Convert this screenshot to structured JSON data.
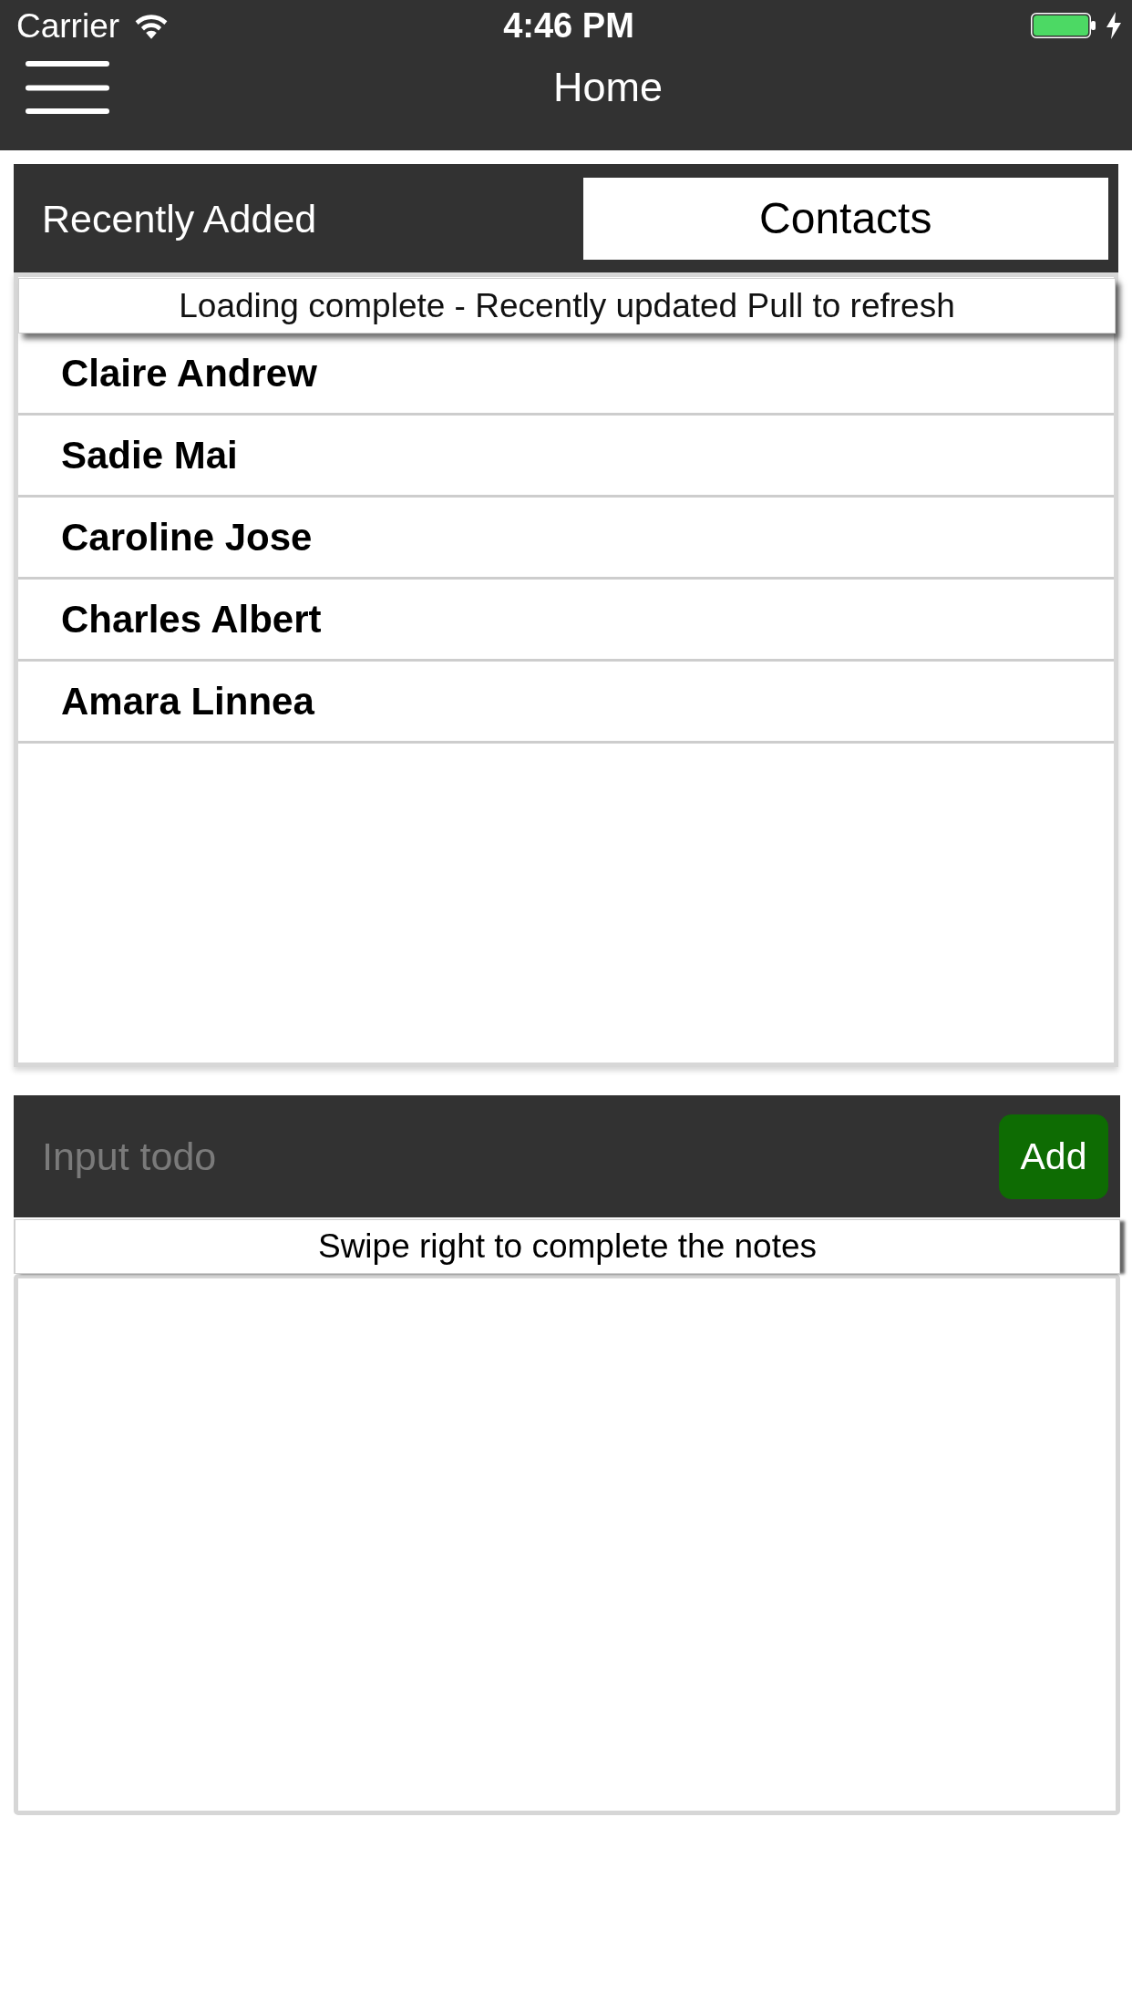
{
  "status_bar": {
    "carrier": "Carrier",
    "time": "4:46 PM"
  },
  "nav_bar": {
    "title": "Home"
  },
  "tabs": [
    {
      "label": "Recently Added",
      "selected": false
    },
    {
      "label": "Contacts",
      "selected": true
    }
  ],
  "contacts": {
    "banner": "Loading complete - Recently updated Pull to refresh",
    "rows": [
      {
        "name": "Claire Andrew"
      },
      {
        "name": "Sadie Mai"
      },
      {
        "name": "Caroline Jose"
      },
      {
        "name": "Charles Albert"
      },
      {
        "name": "Amara Linnea"
      }
    ]
  },
  "todo": {
    "input": {
      "placeholder": "Input todo"
    },
    "add_button": "Add",
    "hint": "Swipe right to complete the notes"
  }
}
